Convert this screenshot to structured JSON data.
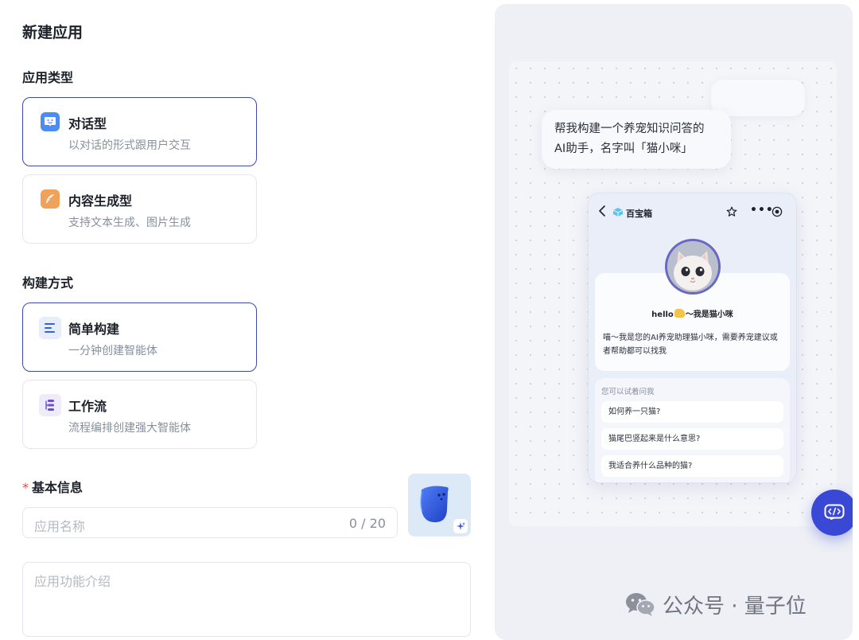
{
  "page": {
    "title": "新建应用"
  },
  "app_type": {
    "label": "应用类型",
    "options": [
      {
        "title": "对话型",
        "desc": "以对话的形式跟用户交互",
        "icon": "chat-face-icon",
        "selected": true
      },
      {
        "title": "内容生成型",
        "desc": "支持文本生成、图片生成",
        "icon": "feather-pen-icon",
        "selected": false
      }
    ]
  },
  "build_method": {
    "label": "构建方式",
    "options": [
      {
        "title": "简单构建",
        "desc": "一分钟创建智能体",
        "icon": "lines-icon",
        "selected": true
      },
      {
        "title": "工作流",
        "desc": "流程编排创建强大智能体",
        "icon": "workflow-icon",
        "selected": false
      }
    ]
  },
  "basic_info": {
    "label": "基本信息",
    "required_mark": "*",
    "name_placeholder": "应用名称",
    "name_counter": "0 / 20",
    "desc_placeholder": "应用功能介绍"
  },
  "preview": {
    "prompt_line1": "帮我构建一个养宠知识问答的",
    "prompt_line2": "AI助手，名字叫「猫小咪」",
    "app_name": "百宝箱",
    "greeting_pre": "hello",
    "greeting_post": "～我是猫小咪",
    "intro": "喵～我是您的AI养宠助理猫小咪，需要养宠建议或者帮助都可以找我",
    "try_label": "您可以试着问我",
    "questions": [
      "如何养一只猫?",
      "猫尾巴竖起来是什么意思?",
      "我适合养什么品种的猫?"
    ]
  },
  "watermark": {
    "text": "公众号 · 量子位"
  },
  "colors": {
    "accent": "#3d4aa9",
    "fab": "#3a48d6",
    "required": "#f53f3f"
  }
}
